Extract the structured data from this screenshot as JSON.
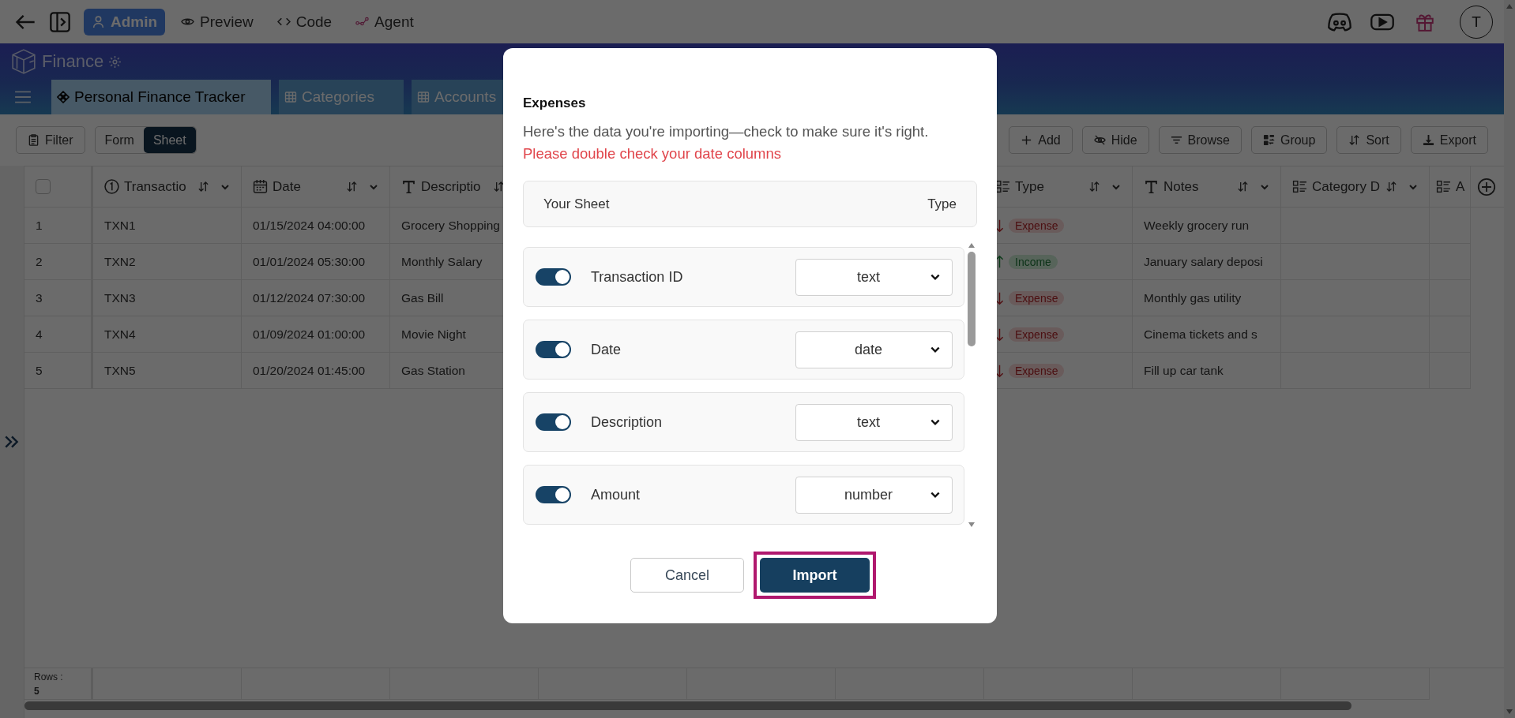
{
  "top_bar": {
    "nav": [
      {
        "label": "Admin",
        "selected": true
      },
      {
        "label": "Preview",
        "selected": false
      },
      {
        "label": "Code",
        "selected": false
      },
      {
        "label": "Agent",
        "selected": false
      }
    ],
    "avatar": "T"
  },
  "app": {
    "title": "Finance",
    "tabs": [
      {
        "label": "Personal Finance Tracker",
        "selected": true
      },
      {
        "label": "Categories",
        "selected": false
      },
      {
        "label": "Accounts",
        "selected": false
      }
    ]
  },
  "toolbar": {
    "filter": "Filter",
    "views": [
      {
        "label": "Form",
        "selected": false
      },
      {
        "label": "Sheet",
        "selected": true
      }
    ],
    "actions": [
      {
        "label": "Add"
      },
      {
        "label": "Hide"
      },
      {
        "label": "Browse"
      },
      {
        "label": "Group"
      },
      {
        "label": "Sort"
      },
      {
        "label": "Export"
      }
    ]
  },
  "table": {
    "select_all": {
      "checked": false
    },
    "columns": [
      {
        "label": "Transactio",
        "kind": "number"
      },
      {
        "label": "Date",
        "kind": "date"
      },
      {
        "label": "Descriptio",
        "kind": "text"
      },
      {
        "label": "Type",
        "kind": "select"
      },
      {
        "label": "Notes",
        "kind": "text"
      },
      {
        "label": "Category D",
        "kind": "select"
      },
      {
        "label": "A",
        "kind": "select"
      }
    ],
    "rows": [
      {
        "index": "1",
        "id": "TXN1",
        "date": "01/15/2024 04:00:00",
        "description": "Grocery Shopping",
        "type": {
          "label": "Expense",
          "kind": "expense"
        },
        "notes": "Weekly grocery run"
      },
      {
        "index": "2",
        "id": "TXN2",
        "date": "01/01/2024 05:30:00",
        "description": "Monthly Salary",
        "type": {
          "label": "Income",
          "kind": "income"
        },
        "notes": "January salary deposi"
      },
      {
        "index": "3",
        "id": "TXN3",
        "date": "01/12/2024 07:30:00",
        "description": "Gas Bill",
        "type": {
          "label": "Expense",
          "kind": "expense"
        },
        "notes": "Monthly gas utility"
      },
      {
        "index": "4",
        "id": "TXN4",
        "date": "01/09/2024 01:00:00",
        "description": "Movie Night",
        "type": {
          "label": "Expense",
          "kind": "expense"
        },
        "notes": "Cinema tickets and s"
      },
      {
        "index": "5",
        "id": "TXN5",
        "date": "01/20/2024 01:45:00",
        "description": "Gas Station",
        "type": {
          "label": "Expense",
          "kind": "expense"
        },
        "notes": "Fill up car tank"
      }
    ],
    "footer": {
      "label": "Rows :",
      "count": "5"
    }
  },
  "dialog": {
    "title": "Expenses",
    "intro": "Here's the data you're importing—check to make sure it's right.",
    "warning": "Please double check your date columns",
    "header": [
      "Your Sheet",
      "Type"
    ],
    "fields": [
      {
        "name": "Transaction ID",
        "on": true,
        "type": "text"
      },
      {
        "name": "Date",
        "on": true,
        "type": "date"
      },
      {
        "name": "Description",
        "on": true,
        "type": "text"
      },
      {
        "name": "Amount",
        "on": true,
        "type": "number"
      }
    ],
    "buttons": [
      {
        "label": "Cancel",
        "kind": "secondary",
        "highlighted": false
      },
      {
        "label": "Import",
        "kind": "primary",
        "highlighted": true
      }
    ]
  }
}
